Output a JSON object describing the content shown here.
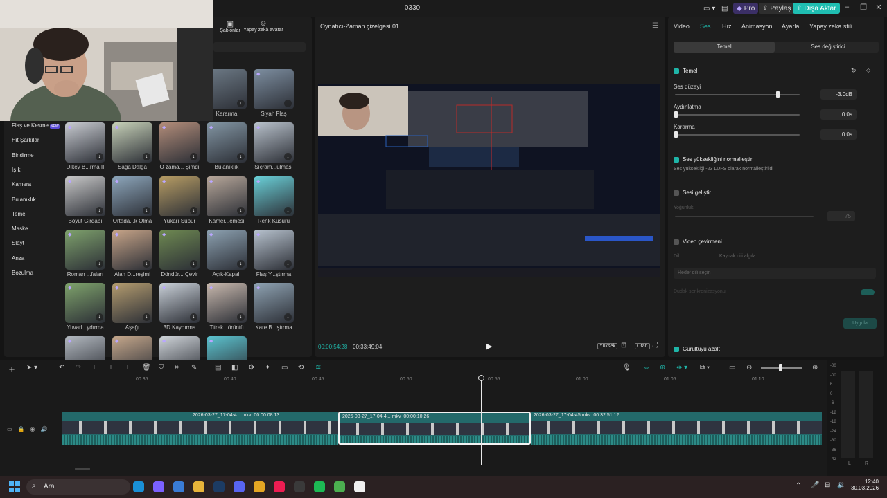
{
  "window": {
    "title": "0330",
    "pro_label": "Pro",
    "share_label": "Paylaş",
    "export_label": "Dışa Aktar"
  },
  "left_panel": {
    "top_tabs": [
      {
        "label": "Şablonlar",
        "icon": "template-icon"
      },
      {
        "label": "Yapay zekâ avatar",
        "icon": "avatar-icon"
      }
    ],
    "categories": [
      "Flaş ve Kesme",
      "Hit Şarkılar",
      "Bindirme",
      "Işık",
      "Kamera",
      "Bulanıklık",
      "Temel",
      "Maske",
      "Slayt",
      "Anza",
      "Bozulma"
    ],
    "category_badge": "NEW",
    "effects": [
      {
        "label": "Kararma",
        "color": "#6d7a86"
      },
      {
        "label": "Siyah Flaş",
        "color": "#7d8ea0"
      },
      {
        "label": "Dikey B...rma II",
        "color": "#c9ccd2"
      },
      {
        "label": "Sağa Dalga",
        "color": "#c7d1b8"
      },
      {
        "label": "O zama... Şimdi",
        "color": "#b38d7a"
      },
      {
        "label": "Bulanıklık",
        "color": "#8396a4"
      },
      {
        "label": "Sıçram...ulması",
        "color": "#b9c2cc"
      },
      {
        "label": "Boyut Girdabı",
        "color": "#c7c7c7"
      },
      {
        "label": "Ortada...k Olma",
        "color": "#8da6bb"
      },
      {
        "label": "Yukarı Süpür",
        "color": "#b69c64"
      },
      {
        "label": "Kamer...emesi",
        "color": "#b7a79a"
      },
      {
        "label": "Renk Kusuru",
        "color": "#6ad0d8"
      },
      {
        "label": "Roman ...faları",
        "color": "#7fa26d"
      },
      {
        "label": "Alan D...reşimi",
        "color": "#c8a589"
      },
      {
        "label": "Döndür... Çevir",
        "color": "#6f8a52"
      },
      {
        "label": "Açık-Kapalı",
        "color": "#8ea3b3"
      },
      {
        "label": "Flaş Y...ştırma",
        "color": "#b8c3cf"
      },
      {
        "label": "Yuvarl...ydırma",
        "color": "#7fa36c"
      },
      {
        "label": "Aşağı",
        "color": "#b49c6f"
      },
      {
        "label": "3D Kaydırma",
        "color": "#c9d0d8"
      },
      {
        "label": "Titrek...örüntü",
        "color": "#c9b9ae"
      },
      {
        "label": "Kare B...ştırma",
        "color": "#8fa3b3"
      },
      {
        "label": "",
        "color": "#b3b9c0"
      },
      {
        "label": "",
        "color": "#c6a88c"
      },
      {
        "label": "",
        "color": "#cfd4d9"
      },
      {
        "label": "",
        "color": "#5cc4d0"
      }
    ]
  },
  "player": {
    "title": "Oynatıcı-Zaman çizelgesi 01",
    "current_time": "00:00:54:28",
    "total_time": "00:33:49:04",
    "quality_label": "Yüksek",
    "ratio_label": "Oran"
  },
  "right_panel": {
    "tabs": [
      "Video",
      "Ses",
      "Hız",
      "Animasyon",
      "Ayarla",
      "Yapay zeka stili"
    ],
    "active_tab": "Ses",
    "subtabs": [
      "Temel",
      "Ses değiştirici"
    ],
    "basic_section": "Temel",
    "volume": {
      "label": "Ses düzeyi",
      "value": "-3.0dB",
      "level": 0.82
    },
    "fade_in": {
      "label": "Aydınlatma",
      "value": "0.0s",
      "level": 0
    },
    "fade_out": {
      "label": "Kararma",
      "value": "0.0s",
      "level": 0
    },
    "normalize": {
      "label": "Ses yüksekliğini normalleştir",
      "desc": "Ses yüksekliği -23 LUFS olarak normalleştirildi"
    },
    "enhance": {
      "label": "Sesi geliştir",
      "intensity_label": "Yoğunluk",
      "intensity_value": "75",
      "level": 0.75
    },
    "translate": {
      "label": "Video çevirmeni",
      "source_placeholder": "Kaynak dili algıla",
      "source_prefix": "Dil",
      "target_placeholder": "Hedef dili seçin",
      "lipsync_label": "Dudak senkronizasyonu",
      "apply_label": "Uygula"
    },
    "denoise": {
      "label": "Gürültüyü azalt"
    }
  },
  "timeline": {
    "ruler": [
      "00:35",
      "00:40",
      "00:45",
      "00:50",
      "00:55",
      "01:00",
      "01:05",
      "01:10"
    ],
    "clips": [
      {
        "name": "2026-03-27_17-04-4... mkv",
        "duration": "00:00:08:13"
      },
      {
        "name": "2026-03-27_17-04-4... mkv",
        "duration": "00:00:10:26"
      },
      {
        "name": "2026-03-27_17-04-45.mkv",
        "duration": "00:32:51:12"
      }
    ],
    "meter_scale": [
      "-00",
      "-00",
      "6",
      "0",
      "-6",
      "-12",
      "-18",
      "-24",
      "-30",
      "-36",
      "-42"
    ],
    "meter_channels": [
      "L",
      "R"
    ]
  },
  "taskbar": {
    "search_label": "Ara",
    "time": "12:40",
    "date": "30.03.2026",
    "apps": [
      {
        "name": "edge-icon",
        "color": "#1a8fd6"
      },
      {
        "name": "copilot-icon",
        "color": "#7b61ff"
      },
      {
        "name": "store-icon",
        "color": "#3a7bd5"
      },
      {
        "name": "files-icon",
        "color": "#e8b43a"
      },
      {
        "name": "steam-icon",
        "color": "#1c3b63"
      },
      {
        "name": "discord-icon",
        "color": "#5865f2"
      },
      {
        "name": "chrome-icon",
        "color": "#e5a623"
      },
      {
        "name": "tiktok-icon",
        "color": "#ee1d52"
      },
      {
        "name": "obs-icon",
        "color": "#3a3a3a"
      },
      {
        "name": "spotify-icon",
        "color": "#1db954"
      },
      {
        "name": "chrome2-icon",
        "color": "#4caf50"
      },
      {
        "name": "capcut-icon",
        "color": "#f0f0f0"
      }
    ]
  }
}
